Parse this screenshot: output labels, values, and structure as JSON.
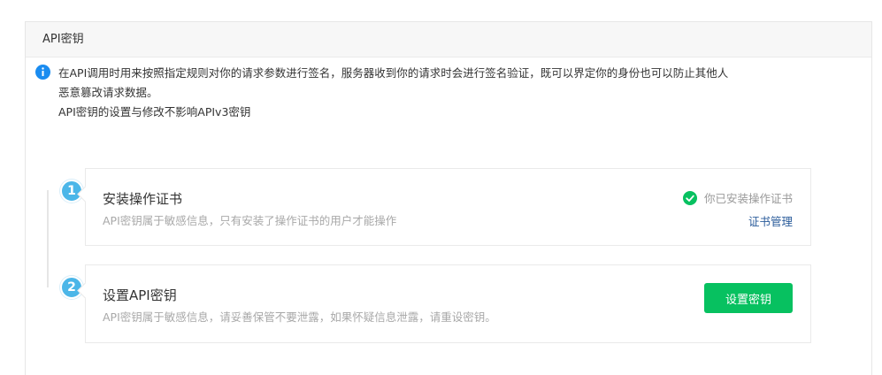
{
  "panel": {
    "title": "API密钥"
  },
  "notice": {
    "icon": "info-icon",
    "line1": "在API调用时用来按照指定规则对你的请求参数进行签名，服务器收到你的请求时会进行签名验证，既可以界定你的身份也可以防止其他人",
    "line2": "恶意篡改请求数据。",
    "line3": "API密钥的设置与修改不影响APIv3密钥"
  },
  "steps": [
    {
      "number": "1",
      "title": "安装操作证书",
      "description": "API密钥属于敏感信息，只有安装了操作证书的用户才能操作",
      "status_text": "你已安装操作证书",
      "status_icon": "check-circle-icon",
      "link_label": "证书管理"
    },
    {
      "number": "2",
      "title": "设置API密钥",
      "description": "API密钥属于敏感信息，请妥善保管不要泄露，如果怀疑信息泄露，请重设密钥。",
      "button_label": "设置密钥"
    }
  ],
  "colors": {
    "accent_green": "#07c160",
    "step_blue": "#4bb6e8",
    "info_blue": "#1a8cf0",
    "link_blue": "#2b5c9b"
  }
}
